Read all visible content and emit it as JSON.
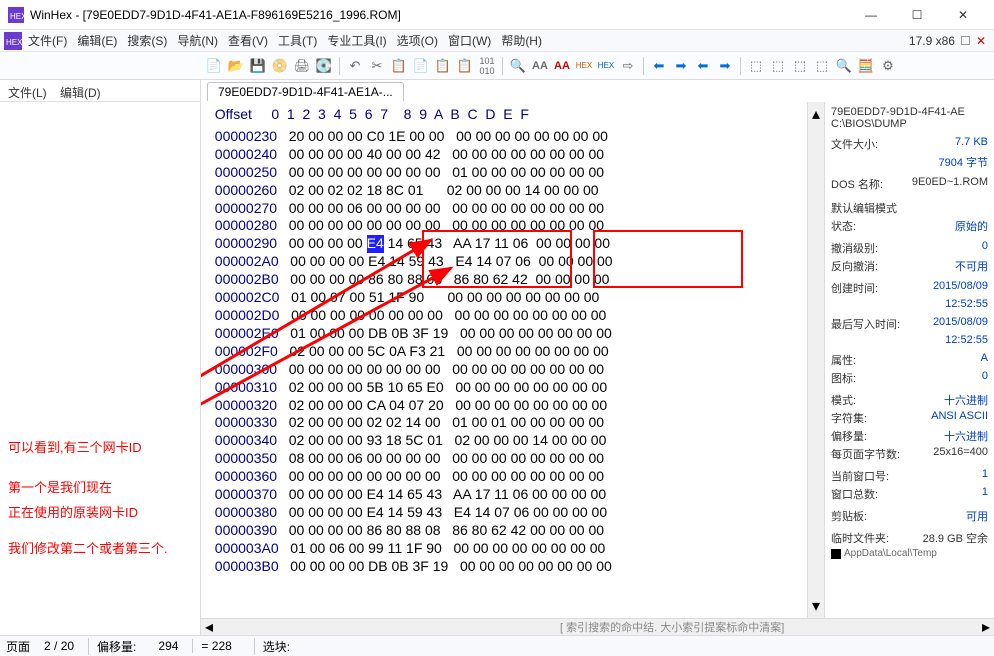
{
  "window": {
    "title": "WinHex - [79E0EDD7-9D1D-4F41-AE1A-F896169E5216_1996.ROM]",
    "zoom": "17.9  x86",
    "min": "—",
    "max": "☐",
    "close": "✕"
  },
  "menu": {
    "file": "文件(F)",
    "edit": "编辑(E)",
    "search": "搜索(S)",
    "nav": "导航(N)",
    "view": "查看(V)",
    "tools": "工具(T)",
    "pro": "专业工具(I)",
    "options": "选项(O)",
    "window": "窗口(W)",
    "help": "帮助(H)"
  },
  "leftmenu": {
    "file": "文件(L)",
    "edit": "编辑(D)"
  },
  "tab": {
    "label": "79E0EDD7-9D1D-4F41-AE1A-..."
  },
  "hex": {
    "offset_label": "Offset",
    "cols": [
      "0",
      "1",
      "2",
      "3",
      "4",
      "5",
      "6",
      "7",
      "8",
      "9",
      "A",
      "B",
      "C",
      "D",
      "E",
      "F"
    ],
    "rows": [
      {
        "o": "00000230",
        "a": "20 00 00 00 C0 1E 00 00",
        "b": "00 00 00 00 00 00 00 00"
      },
      {
        "o": "00000240",
        "a": "00 00 00 00 40 00 00 42",
        "b": "00 00 00 00 00 00 00 00"
      },
      {
        "o": "00000250",
        "a": "00 00 00 00 00 00 00 00",
        "b": "01 00 00 00 00 00 00 00"
      },
      {
        "o": "00000260",
        "a": "02 00 02 02 18 8C 01",
        "b": "02 00 00 00 14 00 00 00"
      },
      {
        "o": "00000270",
        "a": "00 00 00 06 00 00 00 00",
        "b": "00 00 00 00 00 00 00 00"
      },
      {
        "o": "00000280",
        "a": "00 00 00 00 00 00 00 00",
        "b": "00 00 00 00 00 00 00 00"
      },
      {
        "o": "00000290",
        "a": "00 00 00 00",
        "ahl": "E4",
        "a2": "14 65 43",
        "b": "AA 17 11 06",
        "b2": "00 00 00 00"
      },
      {
        "o": "000002A0",
        "a": "00 00 00 00 E4 14 59 43",
        "b": "E4 14 07 06",
        "b2": "00 00 00 00"
      },
      {
        "o": "000002B0",
        "a": "00 00 00 00 86 80 88 08",
        "b": "86 80 62 42",
        "b2": "00 00 00 00"
      },
      {
        "o": "000002C0",
        "a": "01 00 07 00 51 1F 90",
        "b": "00 00 00 00 00 00 00 00"
      },
      {
        "o": "000002D0",
        "a": "00 00 00 00 00 00 00 00",
        "b": "00 00 00 00 00 00 00 00"
      },
      {
        "o": "000002E0",
        "a": "01 00 00 00 DB 0B 3F 19",
        "b": "00 00 00 00 00 00 00 00"
      },
      {
        "o": "000002F0",
        "a": "02 00 00 00 5C 0A F3 21",
        "b": "00 00 00 00 00 00 00 00"
      },
      {
        "o": "00000300",
        "a": "00 00 00 00 00 00 00 00",
        "b": "00 00 00 00 00 00 00 00"
      },
      {
        "o": "00000310",
        "a": "02 00 00 00 5B 10 65 E0",
        "b": "00 00 00 00 00 00 00 00"
      },
      {
        "o": "00000320",
        "a": "02 00 00 00 CA 04 07 20",
        "b": "00 00 00 00 00 00 00 00"
      },
      {
        "o": "00000330",
        "a": "02 00 00 00 02 02 14 00",
        "b": "01 00 01 00 00 00 00 00"
      },
      {
        "o": "00000340",
        "a": "02 00 00 00 93 18 5C 01",
        "b": "02 00 00 00 14 00 00 00"
      },
      {
        "o": "00000350",
        "a": "08 00 00 06 00 00 00 00",
        "b": "00 00 00 00 00 00 00 00"
      },
      {
        "o": "00000360",
        "a": "00 00 00 00 00 00 00 00",
        "b": "00 00 00 00 00 00 00 00"
      },
      {
        "o": "00000370",
        "a": "00 00 00 00 E4 14 65 43",
        "b": "AA 17 11 06 00 00 00 00"
      },
      {
        "o": "00000380",
        "a": "00 00 00 00 E4 14 59 43",
        "b": "E4 14 07 06 00 00 00 00"
      },
      {
        "o": "00000390",
        "a": "00 00 00 00 86 80 88 08",
        "b": "86 80 62 42 00 00 00 00"
      },
      {
        "o": "000003A0",
        "a": "01 00 06 00 99 11 1F 90",
        "b": "00 00 00 00 00 00 00 00"
      },
      {
        "o": "000003B0",
        "a": "00 00 00 00 DB 0B 3F 19",
        "b": "00 00 00 00 00 00 00 00"
      }
    ]
  },
  "annotations": {
    "note1": "可以看到,有三个网卡ID",
    "note2_l1": "第一个是我们现在",
    "note2_l2": "正在使用的原装网卡ID",
    "note3": "我们修改第二个或者第三个."
  },
  "right": {
    "path1": "79E0EDD7-9D1D-4F41-AE",
    "path2": "C:\\BIOS\\DUMP",
    "filesize_l": "文件大小:",
    "filesize_v": "7.7 KB",
    "filesize_b": "7904 字节",
    "dosname_l": "DOS 名称:",
    "dosname_v": "9E0ED~1.ROM",
    "editmode_h": "默认编辑模式",
    "state_l": "状态:",
    "state_v": "原始的",
    "undo_l": "撤消级别:",
    "undo_v": "0",
    "revundo_l": "反向撤消:",
    "revundo_v": "不可用",
    "ctime_l": "创建时间:",
    "ctime_v": "2015/08/09",
    "ctime_t": "12:52:55",
    "wtime_l": "最后写入时间:",
    "wtime_v": "2015/08/09",
    "wtime_t": "12:52:55",
    "attr_l": "属性:",
    "attr_v": "A",
    "icons_l": "图标:",
    "icons_v": "0",
    "mode_l": "模式:",
    "mode_v": "十六进制",
    "charset_l": "字符集:",
    "charset_v": "ANSI ASCII",
    "offset_l": "偏移量:",
    "offset_v": "十六进制",
    "bpp_l": "每页面字节数:",
    "bpp_v": "25x16=400",
    "winno_l": "当前窗口号:",
    "winno_v": "1",
    "wintot_l": "窗口总数:",
    "wintot_v": "1",
    "clip_l": "剪贴板:",
    "clip_v": "可用",
    "temp_l": "临时文件夹:",
    "temp_v": "28.9 GB 空余",
    "temp_p": "AppData\\Local\\Temp"
  },
  "status": {
    "page_l": "页面",
    "page_v": "2 / 20",
    "off_l": "偏移量:",
    "off_v": "294",
    "eq": "= 228",
    "sel_l": "选块:",
    "hint": "[ 索引搜索的命中结.  大小索引提案标命中清案]"
  }
}
